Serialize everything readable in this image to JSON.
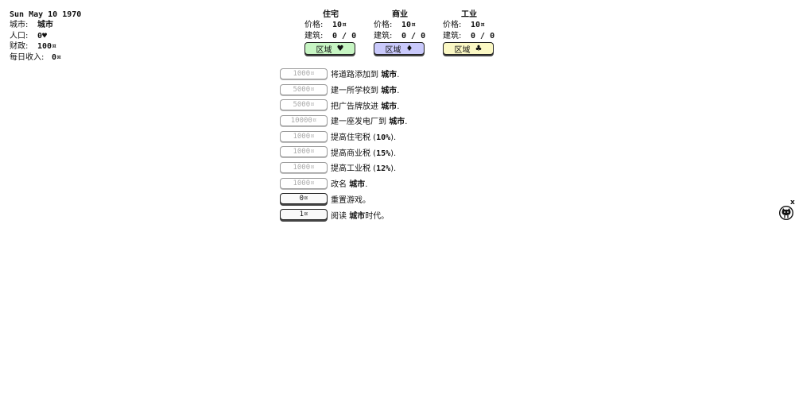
{
  "stats": {
    "date": "Sun May 10 1970",
    "city_label": "城市:",
    "city_value": "城市",
    "population_label": "人口:",
    "population_value": "0♥",
    "treasury_label": "财政:",
    "treasury_value": "100¤",
    "income_label": "每日收入:",
    "income_value": "0¤"
  },
  "zones": [
    {
      "title": "住宅",
      "price_label": "价格:",
      "price_value": "10¤",
      "built_label": "建筑:",
      "built_value": "0 / 0",
      "button_label": "区域",
      "button_symbol": "♥",
      "color": "#c7f5c3"
    },
    {
      "title": "商业",
      "price_label": "价格:",
      "price_value": "10¤",
      "built_label": "建筑:",
      "built_value": "0 / 0",
      "button_label": "区域",
      "button_symbol": "♦",
      "color": "#c9c9fb"
    },
    {
      "title": "工业",
      "price_label": "价格:",
      "price_value": "10¤",
      "built_label": "建筑:",
      "built_value": "0 / 0",
      "button_label": "区域",
      "button_symbol": "♣",
      "color": "#fbf8c4"
    }
  ],
  "actions": [
    {
      "cost": "1000¤",
      "pre": "将道路添加到 ",
      "bold": "城市",
      "post": ".",
      "enabled": false
    },
    {
      "cost": "5000¤",
      "pre": "建一所学校到 ",
      "bold": "城市",
      "post": ".",
      "enabled": false
    },
    {
      "cost": "5000¤",
      "pre": "把广告牌放进 ",
      "bold": "城市",
      "post": ".",
      "enabled": false
    },
    {
      "cost": "10000¤",
      "pre": "建一座发电厂到 ",
      "bold": "城市",
      "post": ".",
      "enabled": false
    },
    {
      "cost": "1000¤",
      "pre": "提高住宅税 (",
      "bold": "10%",
      "post": ").",
      "enabled": false
    },
    {
      "cost": "1000¤",
      "pre": "提高商业税 (",
      "bold": "15%",
      "post": ").",
      "enabled": false
    },
    {
      "cost": "1000¤",
      "pre": "提高工业税 (",
      "bold": "12%",
      "post": ").",
      "enabled": false
    },
    {
      "cost": "1000¤",
      "pre": "改名 ",
      "bold": "城市",
      "post": ".",
      "enabled": false
    },
    {
      "cost": "0¤",
      "pre": "重置游戏。",
      "bold": "",
      "post": "",
      "enabled": true
    },
    {
      "cost": "1¤",
      "pre": "阅读 ",
      "bold": "城市",
      "post": "时代。",
      "enabled": true
    }
  ],
  "corner": {
    "close_label": "x",
    "mascot_icon": "octocat-icon"
  }
}
